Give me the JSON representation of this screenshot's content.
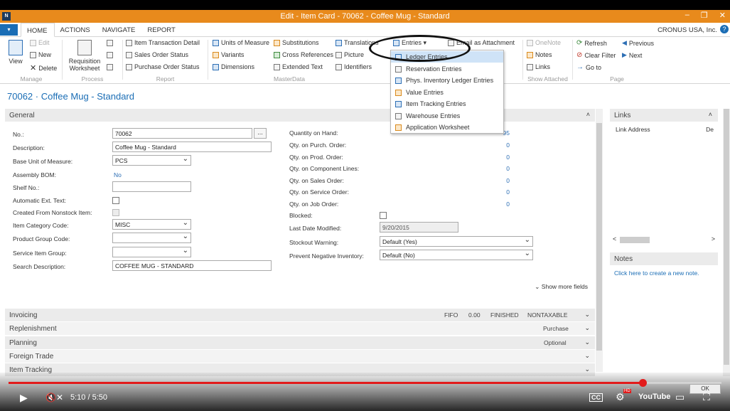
{
  "window": {
    "title": "Edit - Item Card - 70062 - Coffee Mug - Standard",
    "minimize": "–",
    "restore": "❐",
    "close": "✕"
  },
  "ribbon_tabs": {
    "file_glyph": "▾",
    "items": [
      "HOME",
      "ACTIONS",
      "NAVIGATE",
      "REPORT"
    ],
    "company": "CRONUS USA, Inc.",
    "help": "?"
  },
  "ribbon": {
    "manage": {
      "label": "Manage",
      "view": "View",
      "edit": "Edit",
      "new": "New",
      "delete": "Delete"
    },
    "process": {
      "label": "Process",
      "requisition": "Requisition Worksheet"
    },
    "report": {
      "label": "Report",
      "items": [
        "Item Transaction Detail",
        "Sales Order Status",
        "Purchase Order Status"
      ]
    },
    "masterdata": {
      "label": "MasterData",
      "col1": [
        "Units of Measure",
        "Variants",
        "Dimensions"
      ],
      "col2": [
        "Substitutions",
        "Cross References",
        "Extended Text"
      ],
      "col3": [
        "Translations",
        "Picture",
        "Identifiers"
      ]
    },
    "entries": {
      "label": "Entries ▾",
      "email": "Email as Attachment"
    },
    "show_attached": {
      "label": "Show Attached",
      "onenote": "OneNote",
      "notes": "Notes",
      "links": "Links"
    },
    "page": {
      "label": "Page",
      "refresh": "Refresh",
      "clear_filter": "Clear Filter",
      "goto": "Go to",
      "previous": "Previous",
      "next": "Next"
    }
  },
  "entries_menu": [
    "Ledger Entries",
    "Reservation Entries",
    "Phys. Inventory Ledger Entries",
    "Value Entries",
    "Item Tracking Entries",
    "Warehouse Entries",
    "Application Worksheet"
  ],
  "page_title": "70062 · Coffee Mug - Standard",
  "general": {
    "header": "General",
    "left": {
      "no_label": "No.:",
      "no_value": "70062",
      "desc_label": "Description:",
      "desc_value": "Coffee Mug - Standard",
      "base_uom_label": "Base Unit of Measure:",
      "base_uom_value": "PCS",
      "assembly_label": "Assembly BOM:",
      "assembly_value": "No",
      "shelf_label": "Shelf No.:",
      "shelf_value": "",
      "auto_ext_label": "Automatic Ext. Text:",
      "nonstock_label": "Created From Nonstock Item:",
      "item_cat_label": "Item Category Code:",
      "item_cat_value": "MISC",
      "prod_group_label": "Product Group Code:",
      "prod_group_value": "",
      "service_group_label": "Service Item Group:",
      "service_group_value": "",
      "search_label": "Search Description:",
      "search_value": "COFFEE MUG - STANDARD",
      "ellipsis": "..."
    },
    "right": {
      "qoh_label": "Quantity on Hand:",
      "qoh_value": "95",
      "qpo_label": "Qty. on Purch. Order:",
      "qpo_value": "0",
      "qprod_label": "Qty. on Prod. Order:",
      "qprod_value": "0",
      "qcomp_label": "Qty. on Component Lines:",
      "qcomp_value": "0",
      "qso_label": "Qty. on Sales Order:",
      "qso_value": "0",
      "qsvc_label": "Qty. on Service Order:",
      "qsvc_value": "0",
      "qjob_label": "Qty. on Job Order:",
      "qjob_value": "0",
      "blocked_label": "Blocked:",
      "lastmod_label": "Last Date Modified:",
      "lastmod_value": "9/20/2015",
      "stockout_label": "Stockout Warning:",
      "stockout_value": "Default (Yes)",
      "prevneg_label": "Prevent Negative Inventory:",
      "prevneg_value": "Default (No)"
    },
    "show_more": "Show more fields",
    "show_more_chev": "⌄"
  },
  "fasttabs": [
    {
      "title": "Invoicing",
      "summary": [
        "FIFO",
        "0.00",
        "FINISHED",
        "NONTAXABLE"
      ]
    },
    {
      "title": "Replenishment",
      "summary": [
        "Purchase"
      ]
    },
    {
      "title": "Planning",
      "summary": [
        "Optional"
      ]
    },
    {
      "title": "Foreign Trade",
      "summary": []
    },
    {
      "title": "Item Tracking",
      "summary": []
    }
  ],
  "chev_up": "˄",
  "chev_down": "⌄",
  "factbox": {
    "links_title": "Links",
    "links_col1": "Link Address",
    "links_col2": "De",
    "scroll_left": "<",
    "scroll_right": ">",
    "notes_title": "Notes",
    "notes_link": "Click here to create a new note."
  },
  "video": {
    "play": "▶",
    "mute": "🔇✕",
    "time": "5:10 / 5:50",
    "progress": 0.889,
    "cc": "CC",
    "settings": "⚙",
    "hd": "HD",
    "youtube": "YouTube",
    "cast": "▭",
    "fullscreen": "⛶",
    "ok": "OK"
  }
}
